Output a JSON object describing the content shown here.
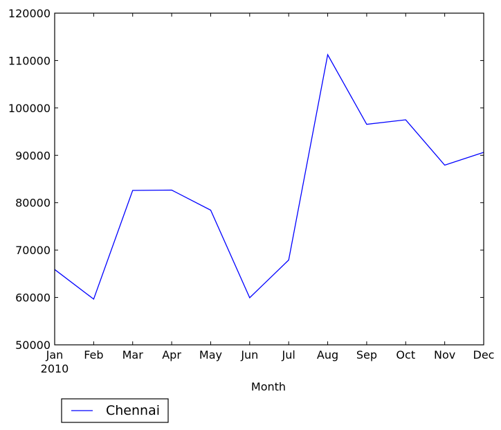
{
  "chart_data": {
    "type": "line",
    "title": "",
    "xlabel": "Month",
    "ylabel": "",
    "categories": [
      "Jan",
      "Feb",
      "Mar",
      "Apr",
      "May",
      "Jun",
      "Jul",
      "Aug",
      "Sep",
      "Oct",
      "Nov",
      "Dec"
    ],
    "x_sublabel": "2010",
    "ylim": [
      50000,
      120000
    ],
    "yticks": [
      50000,
      60000,
      70000,
      80000,
      90000,
      100000,
      110000,
      120000
    ],
    "ytick_labels": [
      "50000",
      "60000",
      "70000",
      "80000",
      "90000",
      "100000",
      "110000",
      "120000"
    ],
    "grid": false,
    "legend": {
      "placement": "below-left",
      "entries": [
        "Chennai"
      ]
    },
    "series": [
      {
        "name": "Chennai",
        "color": "#0000ff",
        "values": [
          65900,
          59650,
          82590,
          82660,
          78420,
          59940,
          67900,
          111230,
          96540,
          97490,
          87920,
          90630
        ]
      }
    ]
  }
}
